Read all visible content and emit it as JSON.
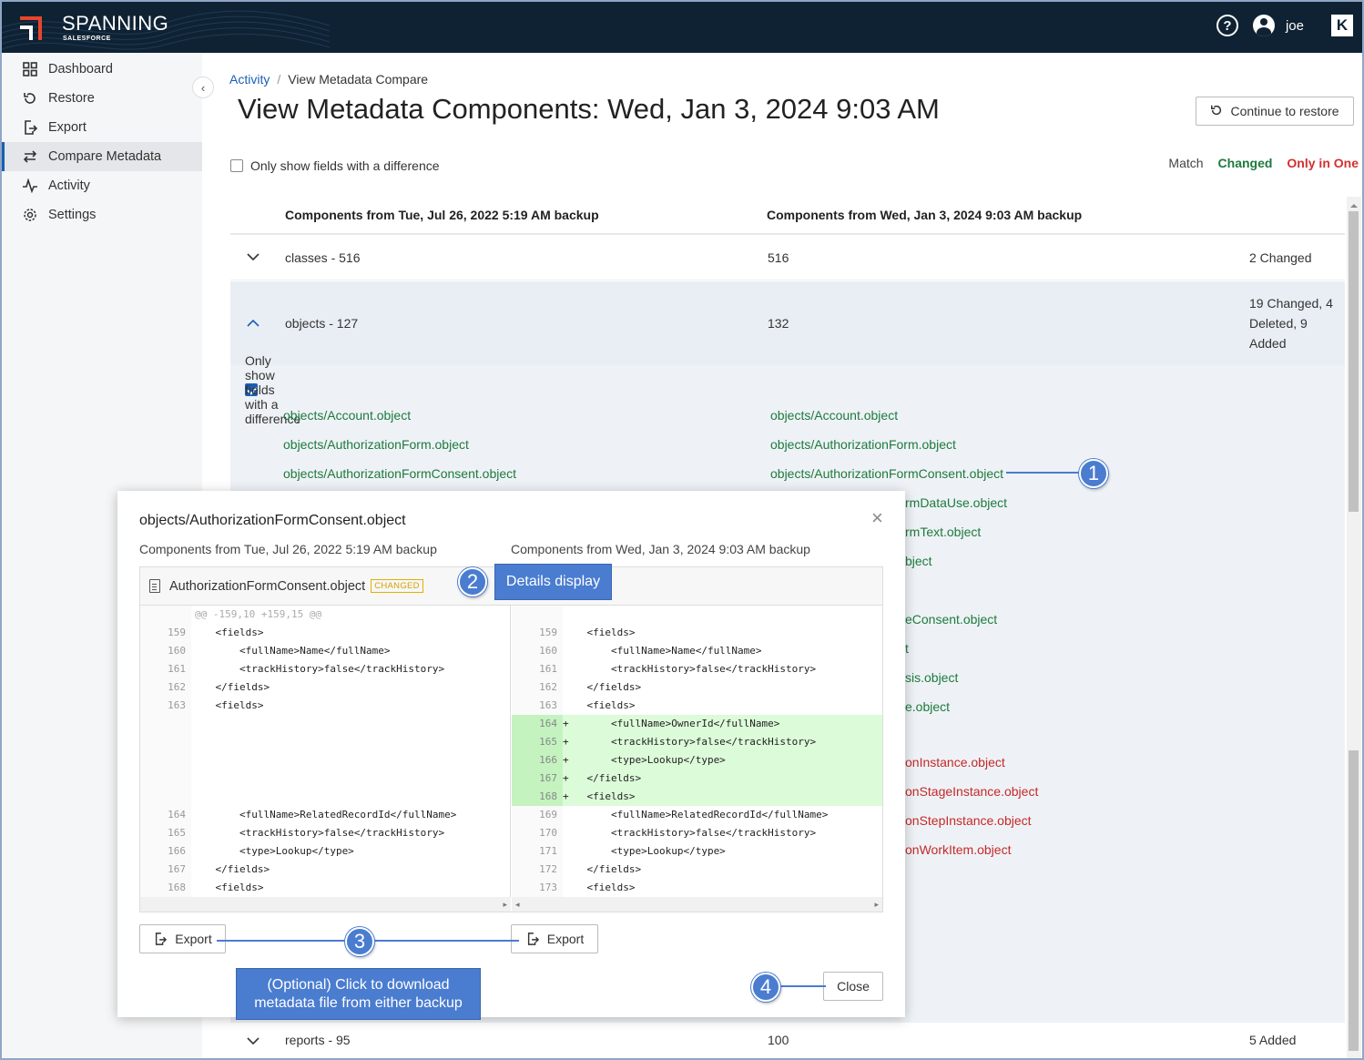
{
  "brand": {
    "name": "SPANNING",
    "sub": "SALESFORCE"
  },
  "topbar": {
    "help_icon": "help-circle-icon",
    "user_icon": "user-circle-icon",
    "username": "joe",
    "app_icon": "k-logo-icon"
  },
  "sidebar": {
    "items": [
      {
        "label": "Dashboard",
        "icon": "grid-icon"
      },
      {
        "label": "Restore",
        "icon": "restore-icon"
      },
      {
        "label": "Export",
        "icon": "export-icon"
      },
      {
        "label": "Compare Metadata",
        "icon": "compare-icon",
        "active": true
      },
      {
        "label": "Activity",
        "icon": "activity-icon"
      },
      {
        "label": "Settings",
        "icon": "gear-icon"
      }
    ]
  },
  "breadcrumb": {
    "link": "Activity",
    "sep": "/",
    "current": "View Metadata Compare"
  },
  "page": {
    "title": "View Metadata Components: Wed, Jan 3, 2024 9:03 AM",
    "continue_label": "Continue to restore",
    "only_diff_label": "Only show fields with a difference"
  },
  "legend": {
    "match": "Match",
    "changed": "Changed",
    "only_in_one": "Only in One"
  },
  "table": {
    "col_left": "Components from Tue, Jul 26, 2022 5:19 AM backup",
    "col_right": "Components from Wed, Jan 3, 2024 9:03 AM backup",
    "rows": [
      {
        "name": "classes - 516",
        "count": "516",
        "status": "2 Changed"
      },
      {
        "name": "objects - 127",
        "count": "132",
        "status1": "19 Changed, 4",
        "status2": "Deleted, 9",
        "status3": "Added"
      },
      {
        "name": "reports - 95",
        "count": "100",
        "status": "5 Added"
      }
    ],
    "inner_only_diff_label": "Only show fields with a difference",
    "left_links": [
      "objects/Account.object",
      "objects/AuthorizationForm.object",
      "objects/AuthorizationFormConsent.object"
    ],
    "right_links": [
      "objects/Account.object",
      "objects/AuthorizationForm.object",
      "objects/AuthorizationFormConsent.object"
    ],
    "right_partial_green": [
      "rmDataUse.object",
      "rmText.object",
      "bject",
      "eConsent.object",
      "t",
      "sis.object",
      "e.object"
    ],
    "right_partial_red": [
      "onInstance.object",
      "onStageInstance.object",
      "onStepInstance.object",
      "onWorkItem.object"
    ]
  },
  "modal": {
    "title": "objects/AuthorizationFormConsent.object",
    "left_header": "Components from Tue, Jul 26, 2022 5:19 AM backup",
    "right_header": "Components from Wed, Jan 3, 2024 9:03 AM backup",
    "file_name": "AuthorizationFormConsent.object",
    "badge": "CHANGED",
    "hunk": "@@ -159,10 +159,15 @@",
    "left_lines": [
      {
        "n": "159",
        "t": "    <fields>"
      },
      {
        "n": "160",
        "t": "        <fullName>Name</fullName>"
      },
      {
        "n": "161",
        "t": "        <trackHistory>false</trackHistory>"
      },
      {
        "n": "162",
        "t": "    </fields>"
      },
      {
        "n": "163",
        "t": "    <fields>"
      },
      {
        "n": "164",
        "t": "        <fullName>RelatedRecordId</fullName>"
      },
      {
        "n": "165",
        "t": "        <trackHistory>false</trackHistory>"
      },
      {
        "n": "166",
        "t": "        <type>Lookup</type>"
      },
      {
        "n": "167",
        "t": "    </fields>"
      },
      {
        "n": "168",
        "t": "    <fields>"
      }
    ],
    "right_lines": [
      {
        "n": "159",
        "t": "    <fields>"
      },
      {
        "n": "160",
        "t": "        <fullName>Name</fullName>"
      },
      {
        "n": "161",
        "t": "        <trackHistory>false</trackHistory>"
      },
      {
        "n": "162",
        "t": "    </fields>"
      },
      {
        "n": "163",
        "t": "    <fields>"
      },
      {
        "n": "164",
        "t": "+       <fullName>OwnerId</fullName>"
      },
      {
        "n": "165",
        "t": "+       <trackHistory>false</trackHistory>"
      },
      {
        "n": "166",
        "t": "+       <type>Lookup</type>"
      },
      {
        "n": "167",
        "t": "+   </fields>"
      },
      {
        "n": "168",
        "t": "+   <fields>"
      },
      {
        "n": "169",
        "t": "        <fullName>RelatedRecordId</fullName>"
      },
      {
        "n": "170",
        "t": "        <trackHistory>false</trackHistory>"
      },
      {
        "n": "171",
        "t": "        <type>Lookup</type>"
      },
      {
        "n": "172",
        "t": "    </fields>"
      },
      {
        "n": "173",
        "t": "    <fields>"
      }
    ],
    "export_label": "Export",
    "close_label": "Close"
  },
  "callouts": {
    "c1": "1",
    "c2": "2",
    "c3": "3",
    "c4": "4",
    "details": "Details display",
    "optional_1": "(Optional) Click to download",
    "optional_2": "metadata file from either backup"
  },
  "colors": {
    "topbar": "#0f2233",
    "accent": "#1a5fb4",
    "changed": "#1e7a3c",
    "only_in_one": "#c62828",
    "callout": "#4a7cd0",
    "added_bg": "#dcfbd9"
  }
}
